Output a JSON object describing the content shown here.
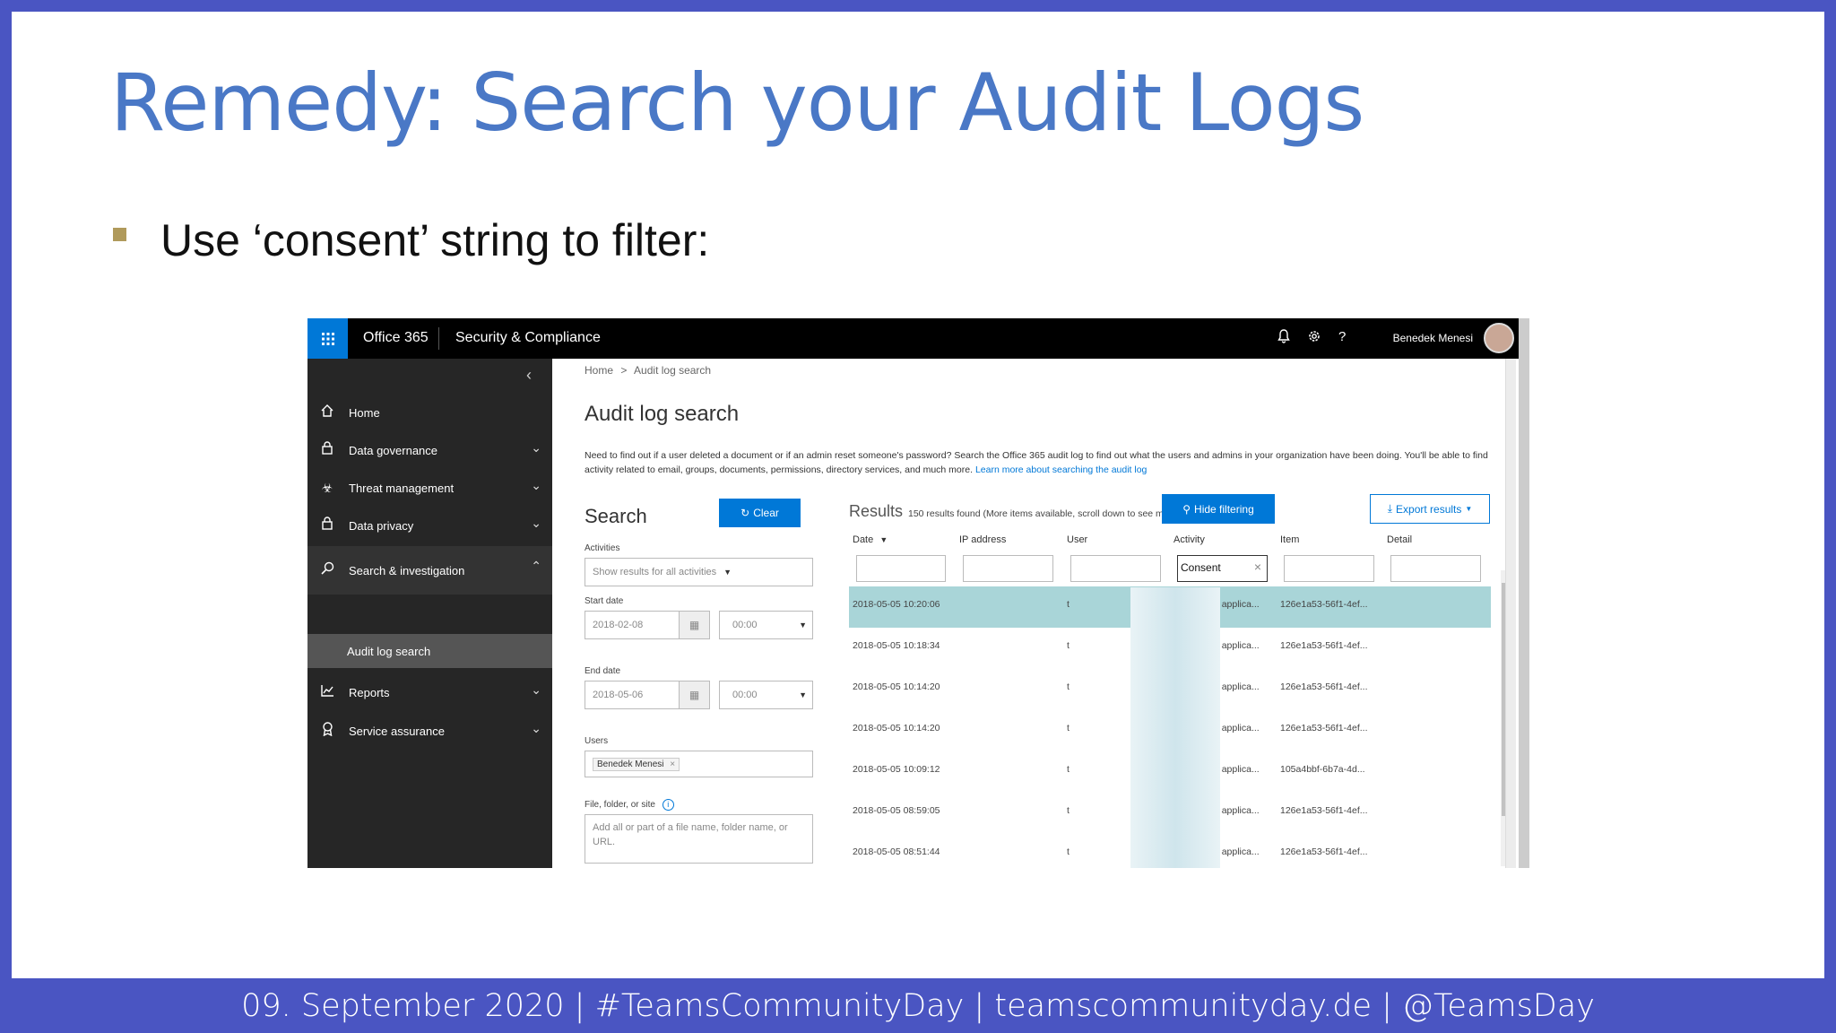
{
  "slide": {
    "title": "Remedy: Search your Audit Logs",
    "bullet": "Use ‘consent’ string to filter:",
    "footer": "09. September 2020 | #TeamsCommunityDay | teamscommunityday.de | @TeamsDay"
  },
  "app": {
    "app_name": "Office 365",
    "section": "Security & Compliance",
    "user_name": "Benedek Menesi",
    "icons": [
      "bell-icon",
      "gear-icon",
      "help-icon"
    ]
  },
  "nav": {
    "items": [
      {
        "label": "Home",
        "icon": "home-icon"
      },
      {
        "label": "Data governance",
        "icon": "lock-icon"
      },
      {
        "label": "Threat management",
        "icon": "biohazard-icon"
      },
      {
        "label": "Data privacy",
        "icon": "lock-icon"
      },
      {
        "label": "Search & investigation",
        "icon": "search-icon"
      },
      {
        "label": "Reports",
        "icon": "chart-icon"
      },
      {
        "label": "Service assurance",
        "icon": "ribbon-icon"
      }
    ],
    "sub_item": "Audit log search"
  },
  "breadcrumb": {
    "home": "Home",
    "sep": ">",
    "current": "Audit log search"
  },
  "page": {
    "title": "Audit log search",
    "description": "Need to find out if a user deleted a document or if an admin reset someone's password? Search the Office 365 audit log to find out what the users and admins in your organization have been doing. You'll be able to find activity related to email, groups, documents, permissions, directory services, and much more.",
    "learn_more": "Learn more about searching the audit log"
  },
  "search": {
    "title": "Search",
    "clear_label": "Clear",
    "activities_label": "Activities",
    "activities_value": "Show results for all activities",
    "start_date_label": "Start date",
    "start_date": "2018-02-08",
    "start_time": "00:00",
    "end_date_label": "End date",
    "end_date": "2018-05-06",
    "end_time": "00:00",
    "users_label": "Users",
    "user_chip": "Benedek Menesi",
    "file_label": "File, folder, or site",
    "file_placeholder": "Add all or part of a file name, folder name, or URL."
  },
  "results": {
    "title": "Results",
    "summary": "150 results found (More items available, scroll down to see more.)",
    "hide_filtering": "Hide filtering",
    "export": "Export results",
    "columns": [
      "Date",
      "IP address",
      "User",
      "Activity",
      "Item",
      "Detail"
    ],
    "activity_filter": "Consent",
    "rows": [
      {
        "date": "2018-05-05 10:20:06",
        "user": "t",
        "activity": "Consent to applica...",
        "item": "126e1a53-56f1-4ef..."
      },
      {
        "date": "2018-05-05 10:18:34",
        "user": "t",
        "activity": "Consent to applica...",
        "item": "126e1a53-56f1-4ef..."
      },
      {
        "date": "2018-05-05 10:14:20",
        "user": "t",
        "activity": "Consent to applica...",
        "item": "126e1a53-56f1-4ef..."
      },
      {
        "date": "2018-05-05 10:14:20",
        "user": "t",
        "activity": "Consent to applica...",
        "item": "126e1a53-56f1-4ef..."
      },
      {
        "date": "2018-05-05 10:09:12",
        "user": "t",
        "activity": "Consent to applica...",
        "item": "105a4bbf-6b7a-4d..."
      },
      {
        "date": "2018-05-05 08:59:05",
        "user": "t",
        "activity": "Consent to applica...",
        "item": "126e1a53-56f1-4ef..."
      },
      {
        "date": "2018-05-05 08:51:44",
        "user": "t",
        "activity": "Consent to applica...",
        "item": "126e1a53-56f1-4ef..."
      }
    ]
  },
  "colors": {
    "frame": "#4a55c2",
    "title": "#4a78c6",
    "accent": "#0078d7",
    "selected_row": "#a9d5d8"
  }
}
